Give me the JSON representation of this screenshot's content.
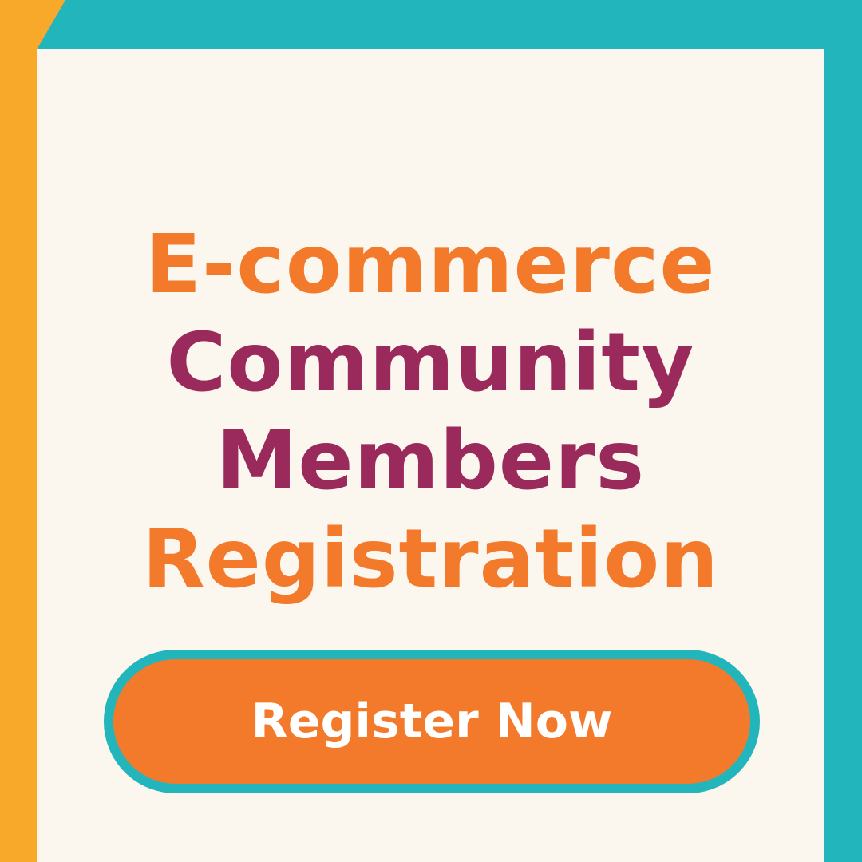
{
  "headline": {
    "line1": "E-commerce",
    "line2": "Community",
    "line3": "Members",
    "line4": "Registration"
  },
  "cta": {
    "label": "Register Now"
  },
  "colors": {
    "orange": "#f47a2b",
    "plum": "#9b2a5c",
    "teal": "#22b5bc",
    "yellow": "#f9a92a",
    "card": "#fbf6ee",
    "button_text": "#ffffff"
  }
}
